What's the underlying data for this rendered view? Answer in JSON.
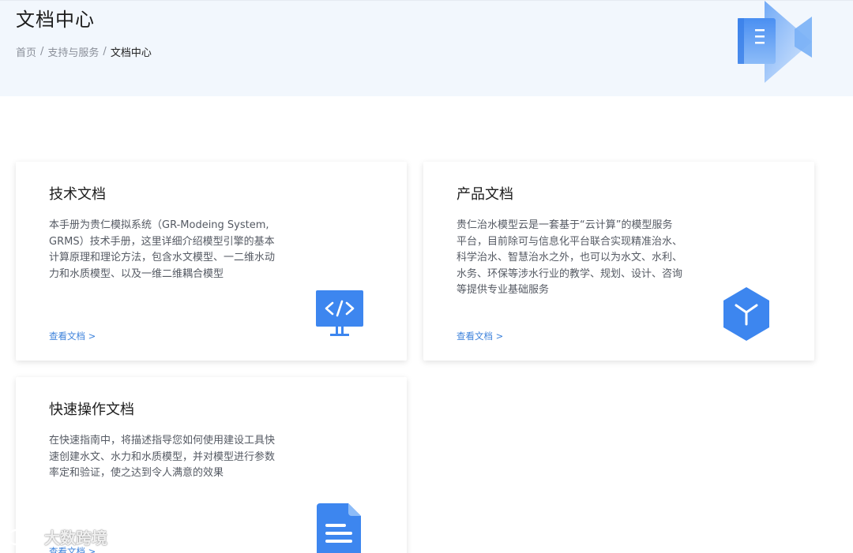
{
  "header": {
    "title": "文档中心",
    "breadcrumb": [
      {
        "label": "首页"
      },
      {
        "label": "支持与服务"
      },
      {
        "label": "文档中心"
      }
    ],
    "separator": "/"
  },
  "cards": [
    {
      "title": "技术文档",
      "description": "本手册为贵仁模拟系统（GR-Modeing System, GRMS）技术手册，这里详细介绍模型引擎的基本计算原理和理论方法，包含水文模型、一二维水动力和水质模型、以及一维二维耦合模型",
      "link": "查看文档 >",
      "icon": "monitor-code-icon"
    },
    {
      "title": "产品文档",
      "description": "贵仁治水模型云是一套基于“云计算”的模型服务平台，目前除可与信息化平台联合实现精准治水、科学治水、智慧治水之外，也可以为水文、水利、水务、环保等涉水行业的教学、规划、设计、咨询等提供专业基础服务",
      "link": "查看文档 >",
      "icon": "cube-icon"
    },
    {
      "title": "快速操作文档",
      "description": "在快速指南中，将描述指导您如何使用建设工具快速创建水文、水力和水质模型，并对模型进行参数率定和验证，使之达到令人满意的效果",
      "link": "查看文档 >",
      "icon": "document-icon"
    }
  ],
  "watermark": {
    "text": "大数跨境"
  },
  "colors": {
    "hero_bg": "#f2f7fd",
    "link": "#3d82db",
    "icon_blue": "#3d86ef"
  }
}
